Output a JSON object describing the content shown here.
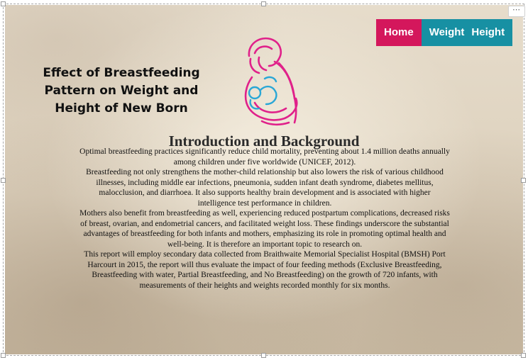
{
  "nav": {
    "items": [
      {
        "label": "Home",
        "active": true
      },
      {
        "label": "Weight",
        "active": false
      },
      {
        "label": "Height",
        "active": false
      }
    ],
    "colors": {
      "active": "#d4175c",
      "inactive": "#1790a3"
    }
  },
  "corner_menu": {
    "label": "⋯"
  },
  "title": {
    "line1": "Effect of Breastfeeding",
    "line2": "Pattern on Weight and",
    "line3": "Height of New Born"
  },
  "logo": {
    "icon": "breastfeeding-mother-icon",
    "colors": {
      "mother": "#e0218a",
      "baby": "#2aa7d6"
    }
  },
  "section": {
    "heading": "Introduction and Background",
    "paragraphs": [
      "Optimal breastfeeding practices significantly reduce child mortality, preventing about 1.4 million deaths annually among children under five worldwide (UNICEF, 2012).",
      "Breastfeeding not only strengthens the mother-child relationship but also lowers the risk of various childhood illnesses, including middle ear infections, pneumonia, sudden infant death syndrome, diabetes mellitus, malocclusion, and diarrhoea. It also supports healthy brain development and is associated with higher intelligence test performance in children.",
      "Mothers also benefit from breastfeeding as well, experiencing reduced postpartum complications, decreased risks of breast, ovarian, and endometrial cancers, and facilitated weight loss. These findings underscore the substantial advantages of breastfeeding for both infants and mothers, emphasizing its role in promoting optimal health and well-being. It is therefore an important topic to research on.",
      "This report will employ secondary data collected from Braithwaite Memorial Specialist Hospital (BMSH) Port Harcourt in 2015, the report will thus evaluate the impact of four feeding methods (Exclusive Breastfeeding, Breastfeeding with water, Partial Breastfeeding, and No Breastfeeding) on the growth of 720 infants, with measurements of their heights and weights recorded monthly for six months."
    ]
  }
}
